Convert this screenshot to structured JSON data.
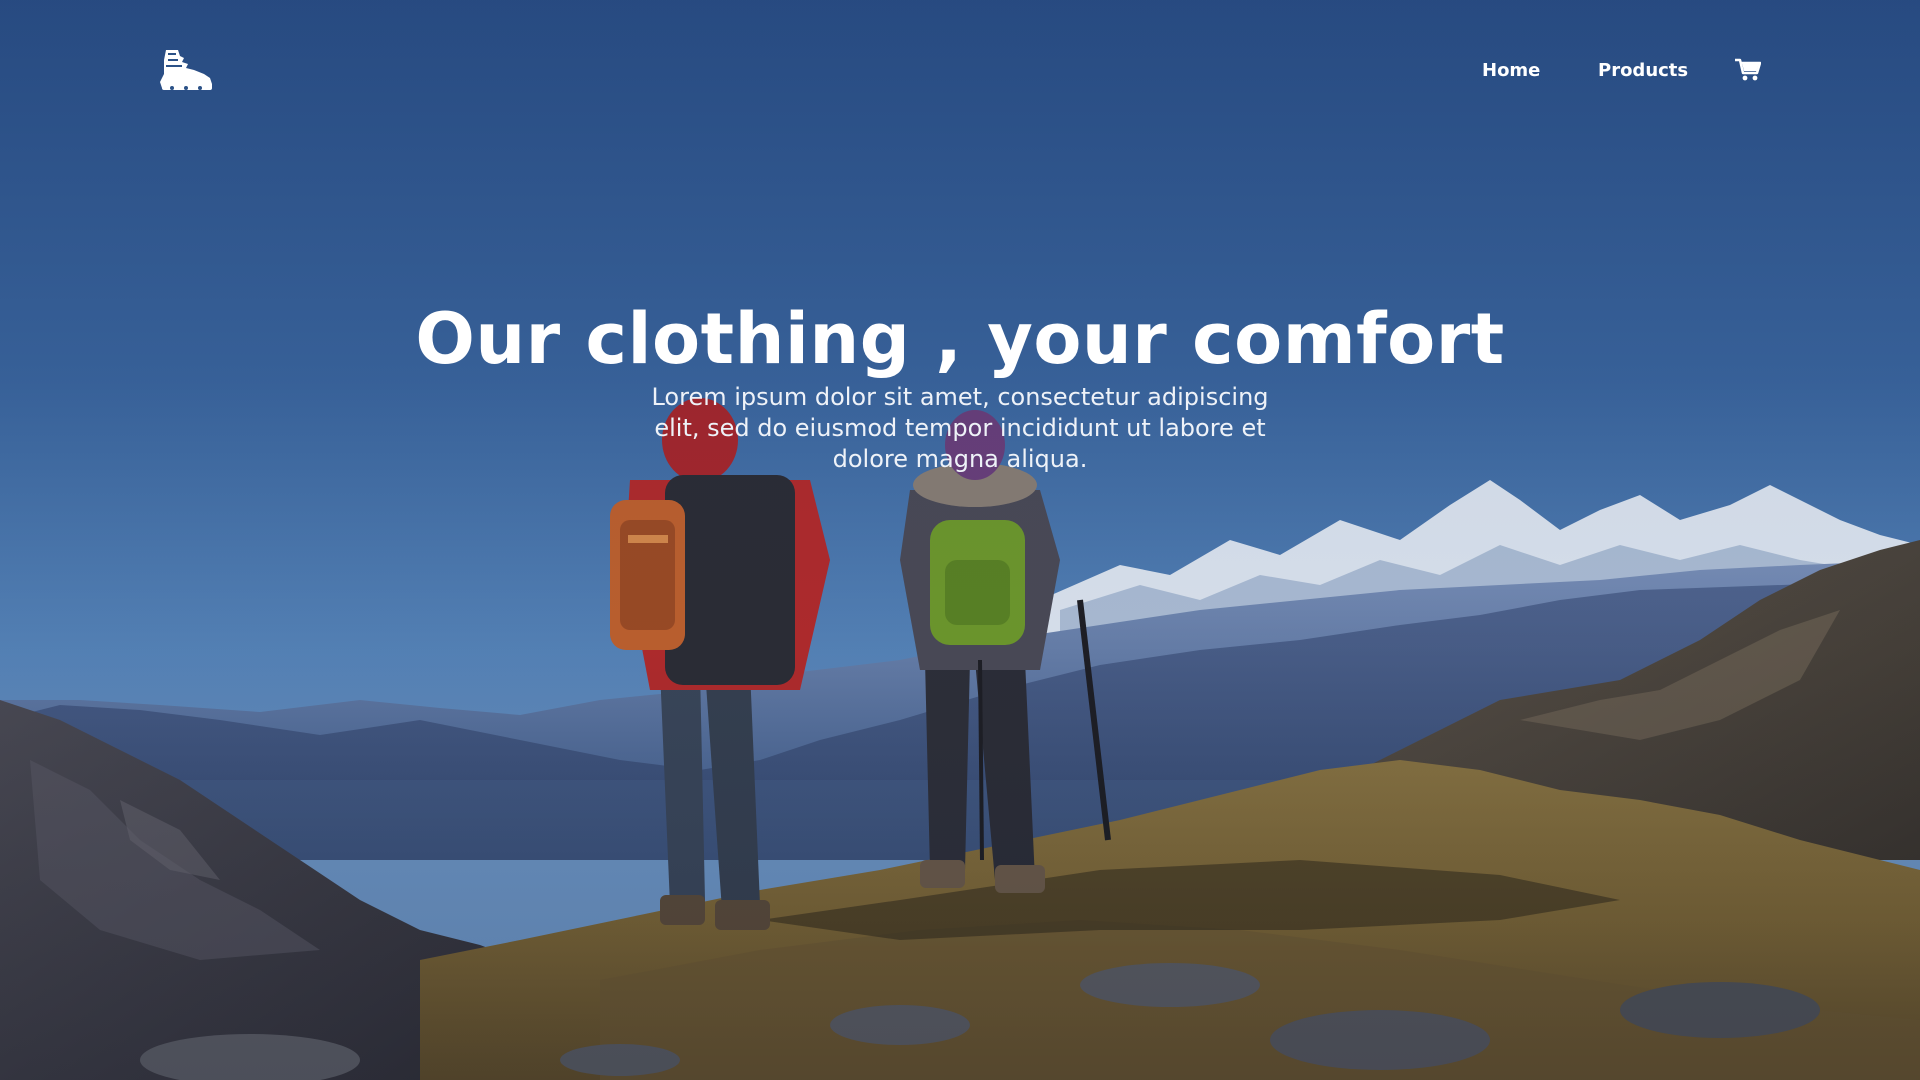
{
  "nav": {
    "logo_icon": "hiking-boot-icon",
    "links": [
      {
        "label": "Home"
      },
      {
        "label": "Products"
      }
    ],
    "cart_icon": "shopping-cart-icon"
  },
  "hero": {
    "title": "Our clothing , your comfort",
    "subtitle": "Lorem ipsum dolor sit amet, consectetur adipiscing elit, sed do eiusmod tempor incididunt ut labore et dolore magna aliqua.",
    "background": "two-hikers-mountain-landscape"
  },
  "colors": {
    "sky_top": "#2b5187",
    "sky_mid": "#4a7aae",
    "text": "#ffffff"
  }
}
